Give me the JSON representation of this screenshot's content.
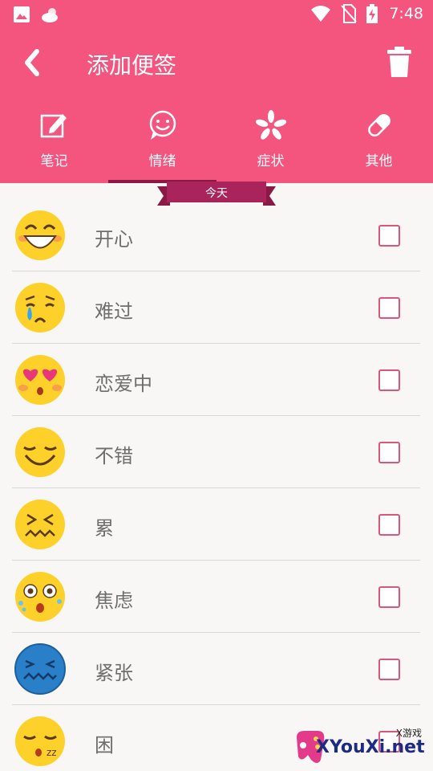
{
  "status_bar": {
    "time": "7:48",
    "icons": [
      "image-icon",
      "weather-cloud-sun-icon",
      "wifi-icon",
      "no-sim-icon",
      "battery-charging-icon"
    ]
  },
  "app_bar": {
    "title": "添加便签",
    "back_icon": "chevron-left-icon",
    "delete_icon": "trash-icon"
  },
  "tabs": [
    {
      "label": "笔记",
      "icon": "note-edit-icon",
      "selected": false
    },
    {
      "label": "情绪",
      "icon": "smiley-icon",
      "selected": true
    },
    {
      "label": "症状",
      "icon": "asterisk-icon",
      "selected": false
    },
    {
      "label": "其他",
      "icon": "pill-icon",
      "selected": false
    }
  ],
  "date_ribbon": "今天",
  "moods": [
    {
      "label": "开心",
      "icon": "happy-face-icon",
      "checked": false
    },
    {
      "label": "难过",
      "icon": "crying-face-icon",
      "checked": false
    },
    {
      "label": "恋爱中",
      "icon": "heart-eyes-face-icon",
      "checked": false
    },
    {
      "label": "不错",
      "icon": "content-face-icon",
      "checked": false
    },
    {
      "label": "累",
      "icon": "tired-face-icon",
      "checked": false
    },
    {
      "label": "焦虑",
      "icon": "anxious-face-icon",
      "checked": false
    },
    {
      "label": "紧张",
      "icon": "nervous-face-icon",
      "checked": false
    },
    {
      "label": "困",
      "icon": "sleepy-face-icon",
      "checked": false
    }
  ],
  "watermark": {
    "small": "X游戏",
    "big": "XYouXi.net"
  },
  "colors": {
    "header": "#f4557f",
    "indicator": "#8a1a45",
    "checkbox": "#d9577a",
    "ribbon": "#a8245a"
  }
}
